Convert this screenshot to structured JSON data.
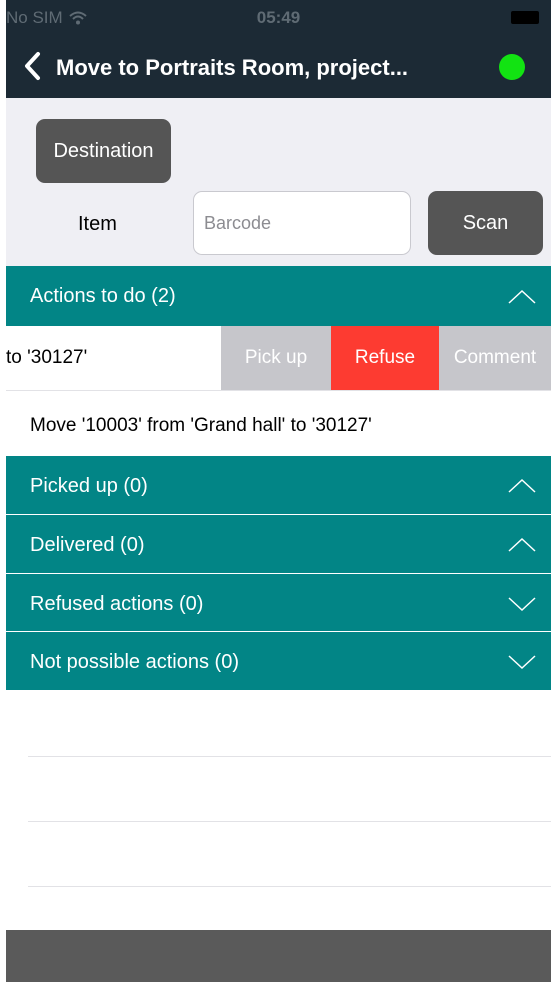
{
  "status_bar": {
    "carrier": "No SIM",
    "time": "05:49"
  },
  "nav": {
    "title": "Move to Portraits Room, project...",
    "status_color": "#12e312"
  },
  "form": {
    "destination_label": "Destination",
    "item_label": "Item",
    "barcode_placeholder": "Barcode",
    "scan_label": "Scan"
  },
  "sections": [
    {
      "label": "Actions to do (2)",
      "chevron": "chevron-up-icon"
    },
    {
      "label": "Picked up (0)",
      "chevron": "chevron-up-icon"
    },
    {
      "label": "Delivered (0)",
      "chevron": "chevron-up-icon"
    },
    {
      "label": "Refused actions (0)",
      "chevron": "chevron-down-icon"
    },
    {
      "label": "Not possible actions (0)",
      "chevron": "chevron-down-icon"
    }
  ],
  "actions": [
    {
      "text": "to '30127'",
      "swipe_actions": [
        "Pick up",
        "Refuse",
        "Comment"
      ]
    },
    {
      "text": "Move '10003' from 'Grand hall' to '30127'"
    }
  ],
  "colors": {
    "header": "#1c2a35",
    "section": "#028586",
    "refuse": "#fd3b31",
    "swipe_action": "#c6c6cb",
    "button": "#555555"
  }
}
